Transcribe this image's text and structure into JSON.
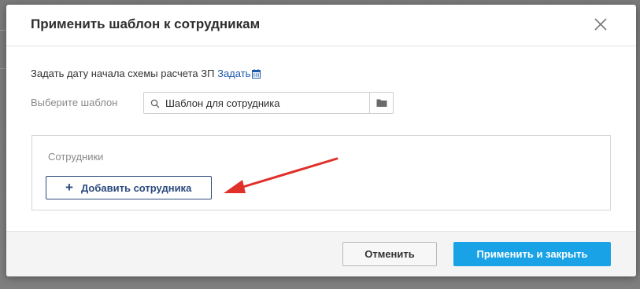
{
  "modal": {
    "title": "Применить шаблон к сотрудникам"
  },
  "date_row": {
    "text": "Задать дату начала схемы расчета ЗП",
    "link": "Задать",
    "icon": "calendar-icon"
  },
  "template": {
    "label": "Выберите шаблон",
    "value": "Шаблон для сотрудника",
    "search_icon": "search-icon",
    "folder_icon": "folder-icon"
  },
  "employees": {
    "title": "Сотрудники",
    "add_button": "Добавить сотрудника",
    "add_icon": "plus-icon"
  },
  "footer": {
    "cancel": "Отменить",
    "apply": "Применить и закрыть"
  },
  "colors": {
    "link": "#1e5aa8",
    "primary_button": "#19a2e6",
    "add_button_border": "#2b4a7d",
    "annotation_arrow": "#e0302a"
  }
}
